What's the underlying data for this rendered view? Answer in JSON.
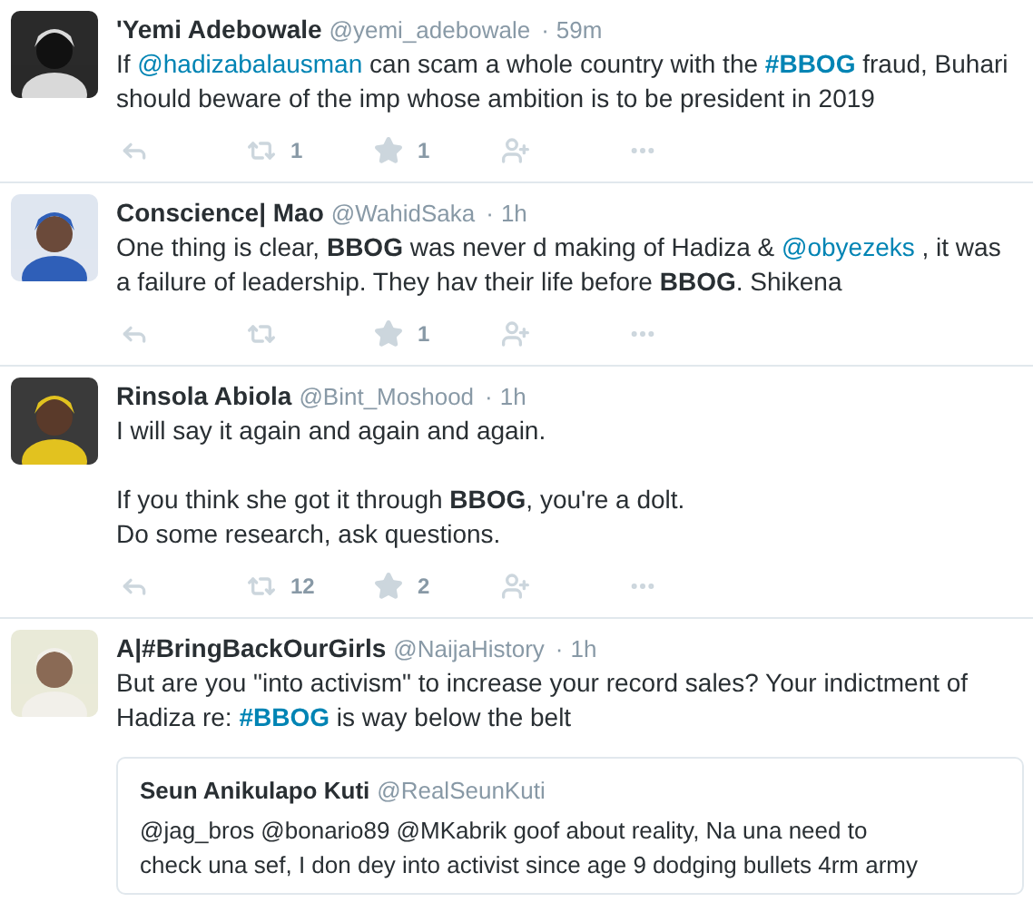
{
  "separator": "·",
  "tweets": [
    {
      "name": "'Yemi Adebowale",
      "handle": "@yemi_adebowale",
      "time": "59m",
      "paragraphs": [
        [
          [
            {
              "kind": "text",
              "text": "If "
            },
            {
              "kind": "mention",
              "text": "@hadizabalausman"
            },
            {
              "kind": "text",
              "text": " can scam a whole country with the "
            },
            {
              "kind": "hashtag",
              "text": "#BBOG"
            },
            {
              "kind": "text",
              "text": " fraud, Buhari"
            }
          ],
          [
            {
              "kind": "text",
              "text": "should beware of the imp whose ambition is to be president in 2019"
            }
          ]
        ]
      ],
      "actions": {
        "retweets": "1",
        "likes": "1"
      }
    },
    {
      "name": "Conscience| Mao",
      "handle": "@WahidSaka",
      "time": "1h",
      "paragraphs": [
        [
          [
            {
              "kind": "text",
              "text": "One thing is clear, "
            },
            {
              "kind": "bold",
              "text": "BBOG"
            },
            {
              "kind": "text",
              "text": " was never d making of Hadiza & "
            },
            {
              "kind": "mention",
              "text": "@obyezeks"
            },
            {
              "kind": "text",
              "text": " , it was"
            }
          ],
          [
            {
              "kind": "text",
              "text": "a failure of leadership. They hav their life before "
            },
            {
              "kind": "bold",
              "text": "BBOG"
            },
            {
              "kind": "text",
              "text": ". Shikena"
            }
          ]
        ]
      ],
      "actions": {
        "likes": "1"
      }
    },
    {
      "name": "Rinsola Abiola",
      "handle": "@Bint_Moshood",
      "time": "1h",
      "paragraphs": [
        [
          [
            {
              "kind": "text",
              "text": "I will say it again and again and again."
            }
          ]
        ],
        [
          [
            {
              "kind": "text",
              "text": "If you think she got it through "
            },
            {
              "kind": "bold",
              "text": "BBOG"
            },
            {
              "kind": "text",
              "text": ", you're a dolt."
            }
          ],
          [
            {
              "kind": "text",
              "text": "Do some research, ask questions."
            }
          ]
        ]
      ],
      "actions": {
        "retweets": "12",
        "likes": "2"
      }
    },
    {
      "name": "A|#BringBackOurGirls",
      "handle": "@NaijaHistory",
      "time": "1h",
      "paragraphs": [
        [
          [
            {
              "kind": "text",
              "text": "But are you \"into activism\" to increase your record sales? Your indictment of"
            }
          ],
          [
            {
              "kind": "text",
              "text": "Hadiza re: "
            },
            {
              "kind": "hashtag",
              "text": "#BBOG"
            },
            {
              "kind": "text",
              "text": " is way below the belt"
            }
          ]
        ]
      ],
      "quote": {
        "name": "Seun Anikulapo Kuti",
        "handle": "@RealSeunKuti",
        "lines": [
          "@jag_bros @bonario89 @MKabrik goof about reality, Na una need to",
          "check una sef, I don dey into activist since age 9 dodging bullets 4rm army"
        ]
      }
    }
  ]
}
